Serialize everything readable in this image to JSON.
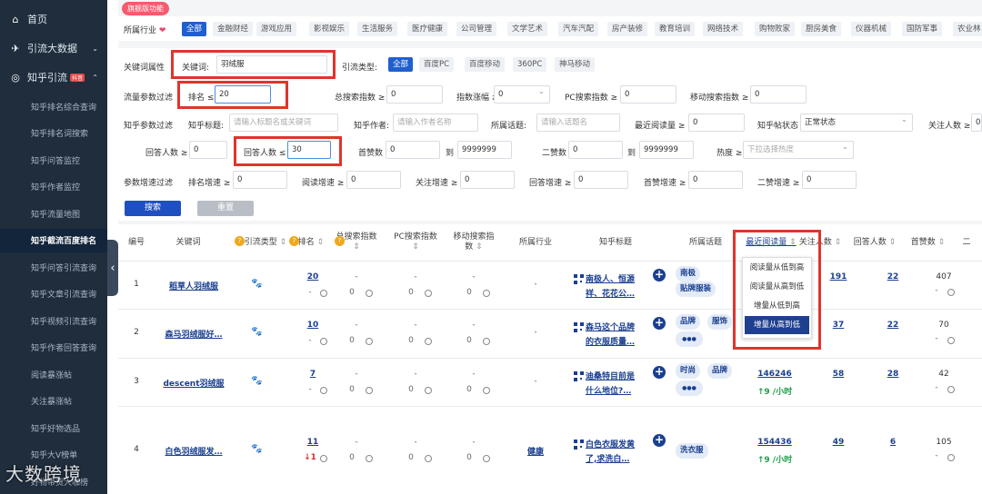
{
  "sidebar": {
    "items": [
      {
        "icon": "home-icon",
        "label": "首页"
      },
      {
        "icon": "plane-icon",
        "label": "引流大数据"
      },
      {
        "icon": "knowledge-icon",
        "label": "知乎引流",
        "badge": "抖音"
      }
    ],
    "sub": [
      "知乎排名综合查询",
      "知乎排名词搜索",
      "知乎问答监控",
      "知乎作者监控",
      "知乎流量地图",
      "知乎截流百度排名",
      "知乎问答引流查询",
      "知乎文章引流查询",
      "知乎视频引流查询",
      "知乎作者回答查询",
      "阅读暴涨帖",
      "关注暴涨帖",
      "知乎好物选品",
      "知乎大V榜单",
      "好物带货大咖榜"
    ],
    "active_index": 5,
    "watermark": "大数跨境"
  },
  "badge": "旗舰版功能",
  "industry": {
    "label": "所属行业",
    "tags": [
      "全部",
      "金融财经",
      "游戏应用",
      "影视娱乐",
      "生活服务",
      "医疗健康",
      "公司管理",
      "文学艺术",
      "汽车汽配",
      "房产装修",
      "教育培训",
      "网络技术",
      "购物败家",
      "厨房美食",
      "仪器机械",
      "国防军事",
      "农业林"
    ]
  },
  "filters": {
    "kw_attr": "关键词属性",
    "kw_label": "关键词:",
    "kw_value": "羽绒服",
    "type_label": "引流类型:",
    "type_tags": [
      "全部",
      "百度PC",
      "百度移动",
      "360PC",
      "神马移动"
    ],
    "flow_label": "流量参数过滤",
    "rank_label": "排名 ≤",
    "rank_value": "20",
    "total_idx": "总搜索指数 ≥",
    "total_val": "0",
    "idx_up": "指数涨幅 ≥",
    "idx_up_val": "0",
    "pc_idx": "PC搜索指数 ≥",
    "pc_val": "0",
    "mob_idx": "移动搜索指数 ≥",
    "mob_val": "0",
    "zh_label": "知乎参数过滤",
    "title_label": "知乎标题:",
    "title_ph": "请输入标题名或关键词",
    "author_label": "知乎作者:",
    "author_ph": "请输入作者名称",
    "topic_label": "所属话题:",
    "topic_ph": "请输入话题名",
    "read_label": "最近阅读量 ≥",
    "read_val": "0",
    "status_label": "知乎帖状态",
    "status_val": "正常状态",
    "follow_label": "关注人数 ≥",
    "follow_val": "0",
    "ans_ge_label": "回答人数 ≥",
    "ans_ge_val": "0",
    "ans_le_label": "回答人数 ≤",
    "ans_le_val": "30",
    "likes_label": "首赞数",
    "likes_from": "0",
    "to1": "到",
    "likes_to": "9999999",
    "likes2_label": "二赞数",
    "likes2_from": "0",
    "to2": "到",
    "likes2_to": "9999999",
    "heat_label": "热度 ≥",
    "heat_val": "下拉选择热度",
    "speed_label": "参数增速过滤",
    "speed": [
      {
        "l": "排名增速 ≥",
        "v": "0"
      },
      {
        "l": "阅读增速 ≥",
        "v": "0"
      },
      {
        "l": "关注增速 ≥",
        "v": "0"
      },
      {
        "l": "回答增速 ≥",
        "v": "0"
      },
      {
        "l": "首赞增速 ≥",
        "v": "0"
      },
      {
        "l": "二赞增速 ≥",
        "v": "0"
      }
    ],
    "search_btn": "搜索",
    "reset_btn": "重置"
  },
  "table": {
    "headers": [
      "编号",
      "关键词",
      "引流类型",
      "排名",
      "总搜索指数",
      "PC搜索指数",
      "移动搜索指数",
      "所属行业",
      "知乎标题",
      "所属话题",
      "最近阅读量",
      "关注人数",
      "回答人数",
      "首赞数",
      "二"
    ],
    "rows": [
      {
        "no": "1",
        "kw": "稻草人羽绒服",
        "rank": "20",
        "rank_d": "-",
        "total": "-",
        "total_d": "0",
        "pc": "-",
        "pc_d": "0",
        "mob": "-",
        "mob_d": "0",
        "ind": "-",
        "title1": "南极人、恒源",
        "title2": "祥、花花公…",
        "topics": [
          "南极",
          "贴牌服装"
        ],
        "read": "",
        "read_d": "",
        "follow": "191",
        "ans": "22",
        "likes": "407",
        "likes_d": "-"
      },
      {
        "no": "2",
        "kw": "森马羽绒服好…",
        "rank": "10",
        "rank_d": "-",
        "total": "-",
        "total_d": "0",
        "pc": "-",
        "pc_d": "0",
        "mob": "-",
        "mob_d": "0",
        "ind": "-",
        "title1": "森马这个品牌",
        "title2": "的衣服质量…",
        "topics": [
          "品牌",
          "服饰"
        ],
        "read": "",
        "read_d": "",
        "follow": "37",
        "ans": "22",
        "likes": "70",
        "likes_d": "-"
      },
      {
        "no": "3",
        "kw": "descent羽绒服",
        "rank": "7",
        "rank_d": "-",
        "total": "-",
        "total_d": "0",
        "pc": "-",
        "pc_d": "0",
        "mob": "-",
        "mob_d": "0",
        "ind": "-",
        "title1": "迪桑特目前是",
        "title2": "什么地位?…",
        "topics": [
          "时尚",
          "品牌"
        ],
        "read": "146246",
        "read_d": "↑9 /小时",
        "follow": "58",
        "ans": "28",
        "likes": "42",
        "likes_d": "-"
      },
      {
        "no": "4",
        "kw": "白色羽绒服发…",
        "rank": "11",
        "rank_d": "↓1",
        "total": "-",
        "total_d": "0",
        "pc": "-",
        "pc_d": "0",
        "mob": "-",
        "mob_d": "0",
        "ind": "健康",
        "title1": "白色衣服发黄",
        "title2": "了,求洗白…",
        "topics": [
          "洗衣服"
        ],
        "read": "154436",
        "read_d": "↑9 /小时",
        "follow": "49",
        "ans": "6",
        "likes": "105",
        "likes_d": "-"
      }
    ]
  },
  "dropdown": {
    "items": [
      "阅读量从低到高",
      "阅读量从高到低",
      "增量从低到高",
      "增量从高到低"
    ],
    "selected": 3
  }
}
